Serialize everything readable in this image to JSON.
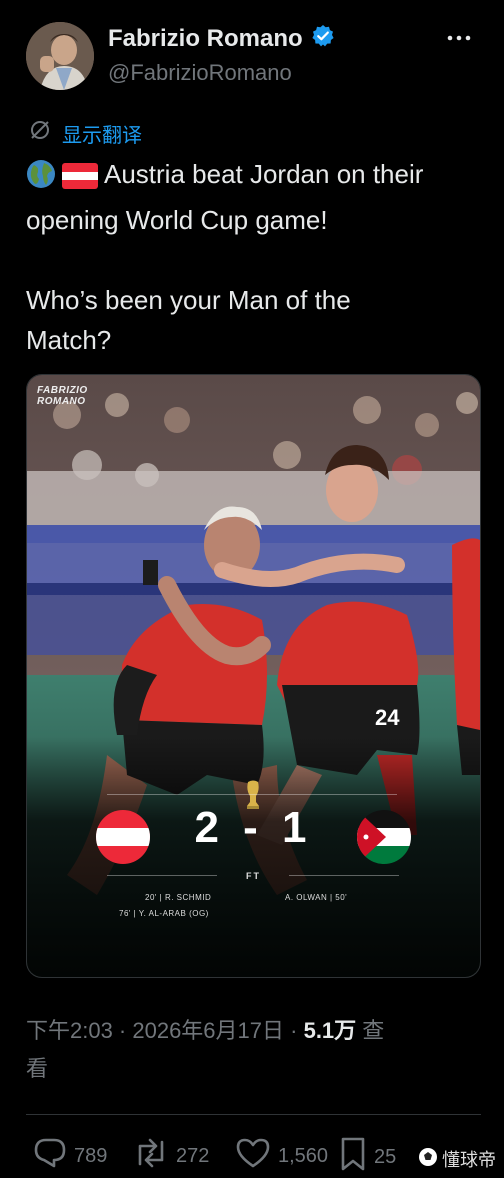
{
  "author": {
    "display_name": "Fabrizio Romano",
    "handle": "@FabrizioRomano"
  },
  "translate_label": "显示翻译",
  "tweet": {
    "line1": "Austria beat Jordan on their",
    "line2": "opening World Cup game!",
    "line3": "Who’s been your Man of the",
    "line4": "Match?"
  },
  "media": {
    "watermark_line1": "FABRIZIO",
    "watermark_line2": "ROMANO",
    "player_number": "24",
    "score": "2 - 1",
    "status": "FT",
    "scorer1": "20' | R. SCHMID",
    "scorer2": "76' | Y. AL-ARAB (OG)",
    "scorer3": "A. OLWAN | 50'"
  },
  "meta": {
    "time_date": "下午2:03 · 2026年6月17日 · ",
    "views": "5.1万",
    "views_label": " 查",
    "views_label2": "看"
  },
  "actions": {
    "replies": "789",
    "reposts": "272",
    "likes": "1,560",
    "bookmarks": "25"
  },
  "brand_text": "懂球帝",
  "colors": {
    "verified": "#1d9bf0",
    "link": "#1d9bf0",
    "muted": "#71767b"
  }
}
